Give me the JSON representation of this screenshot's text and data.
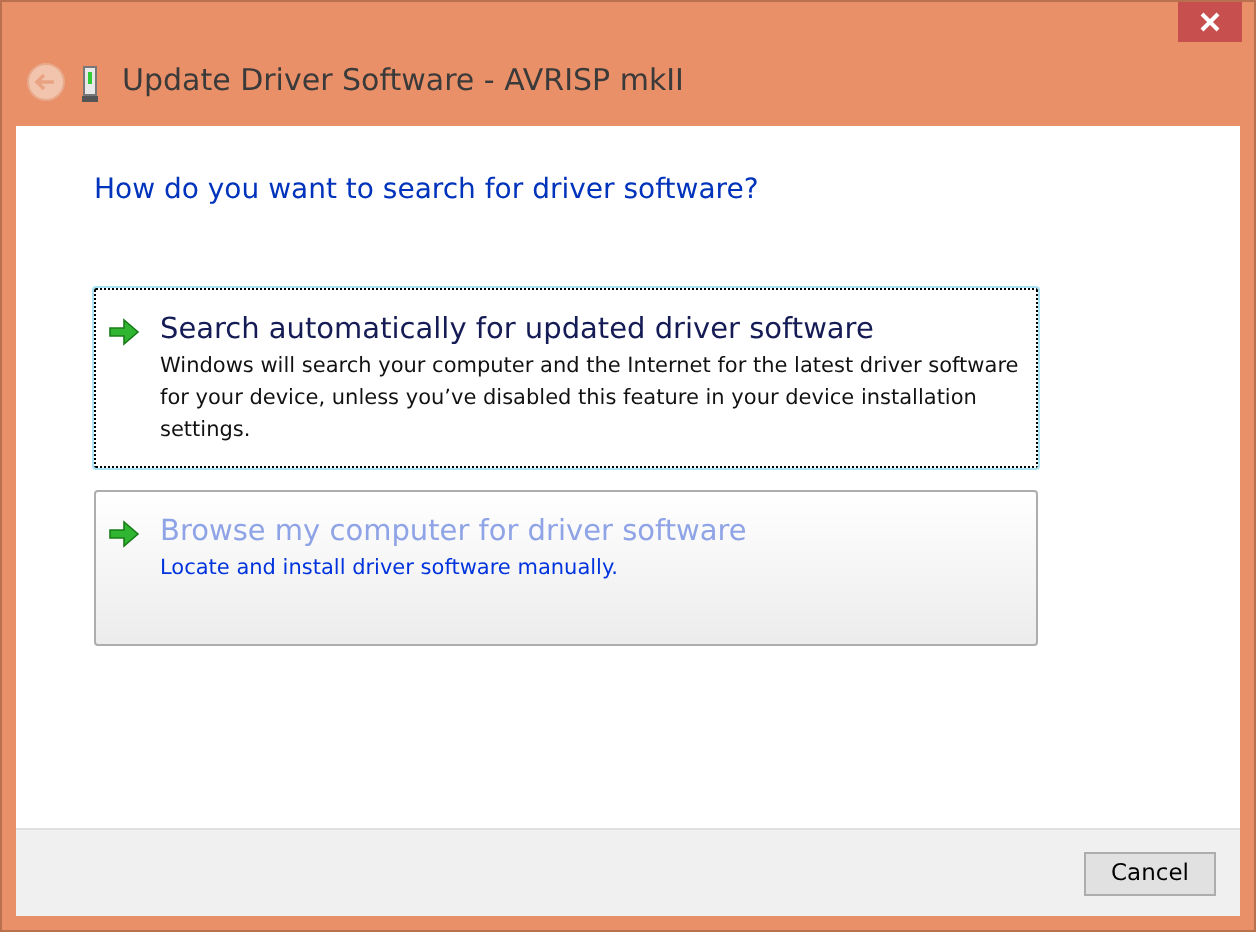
{
  "window": {
    "title": "Update Driver Software - AVRISP mkII"
  },
  "heading": "How do you want to search for driver software?",
  "options": [
    {
      "title": "Search automatically for updated driver software",
      "description": "Windows will search your computer and the Internet for the latest driver software for your device, unless you’ve disabled this feature in your device installation settings.",
      "focused": true,
      "hovered": false
    },
    {
      "title": "Browse my computer for driver software",
      "description": "Locate and install driver software manually.",
      "focused": false,
      "hovered": true
    }
  ],
  "buttons": [
    "Cancel"
  ]
}
